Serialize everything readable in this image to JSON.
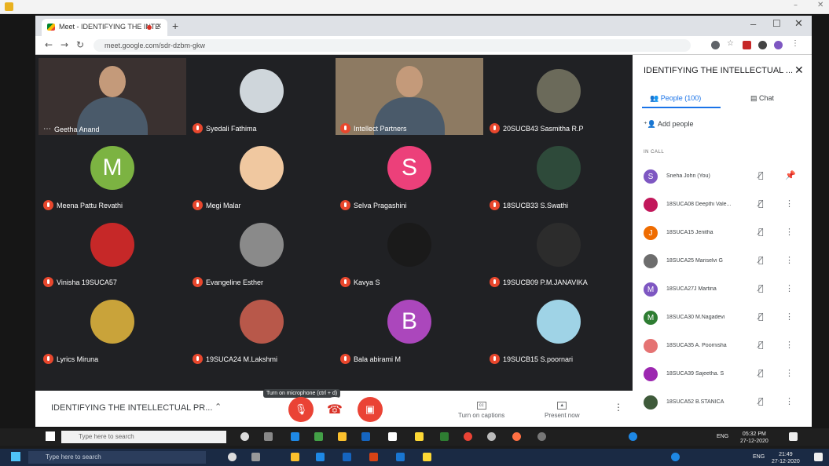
{
  "browser": {
    "tab_title": "Meet - IDENTIFYING THE INTE",
    "url": "meet.google.com/sdr-dzbm-gkw"
  },
  "tiles": [
    {
      "name": "Geetha Anand",
      "kind": "video",
      "bg": "#3a3130",
      "muted": false
    },
    {
      "name": "Syedali Fathima",
      "kind": "avatar",
      "avatar_bg": "#cfd6db",
      "muted": true
    },
    {
      "name": "Intellect Partners",
      "kind": "video",
      "bg": "#8d7a62",
      "muted": true
    },
    {
      "name": "20SUCB43 Sasmitha R.P",
      "kind": "avatar",
      "avatar_bg": "#6b6a5a",
      "muted": true
    },
    {
      "name": "Meena Pattu Revathi",
      "kind": "letter",
      "letter": "M",
      "avatar_bg": "#7cb342",
      "muted": true
    },
    {
      "name": "Megi Malar",
      "kind": "avatar",
      "avatar_bg": "#f0c8a0",
      "muted": true
    },
    {
      "name": "Selva Pragashini",
      "kind": "letter",
      "letter": "S",
      "avatar_bg": "#ec407a",
      "muted": true
    },
    {
      "name": "18SUCB33 S.Swathi",
      "kind": "avatar",
      "avatar_bg": "#2e4a3a",
      "muted": true
    },
    {
      "name": "Vinisha 19SUCA57",
      "kind": "avatar",
      "avatar_bg": "#c62828",
      "muted": true
    },
    {
      "name": "Evangeline Esther",
      "kind": "avatar",
      "avatar_bg": "#8a8a8a",
      "muted": true
    },
    {
      "name": "Kavya S",
      "kind": "avatar",
      "avatar_bg": "#1a1a1a",
      "muted": true
    },
    {
      "name": "19SUCB09 P.M.JANAVIKA",
      "kind": "avatar",
      "avatar_bg": "#2c2c2c",
      "muted": true
    },
    {
      "name": "Lyrics Miruna",
      "kind": "avatar",
      "avatar_bg": "#c9a33a",
      "muted": true
    },
    {
      "name": "19SUCA24 M.Lakshmi",
      "kind": "avatar",
      "avatar_bg": "#b8584a",
      "muted": true
    },
    {
      "name": "Bala abirami M",
      "kind": "letter",
      "letter": "B",
      "avatar_bg": "#ab47bc",
      "muted": true
    },
    {
      "name": "19SUCB15 S.poornari",
      "kind": "avatar",
      "avatar_bg": "#9fd3e6",
      "muted": true
    }
  ],
  "bottombar": {
    "meeting_title": "IDENTIFYING THE INTELLECTUAL PR...",
    "tooltip": "Turn on microphone (ctrl + d)",
    "captions_label": "Turn on captions",
    "present_label": "Present now"
  },
  "panel": {
    "title": "IDENTIFYING THE INTELLECTUAL ...",
    "people_tab": "People (100)",
    "chat_tab": "Chat",
    "add_people": "Add people",
    "in_call_label": "IN CALL",
    "people": [
      {
        "name": "Sneha John (You)",
        "initial": "S",
        "color": "#7e57c2",
        "action": "pin-icon"
      },
      {
        "name": "18SUCA08 Deepthi Vale...",
        "initial": "",
        "color": "#c2185b",
        "action": "more-icon"
      },
      {
        "name": "18SUCA15 Jenitha",
        "initial": "J",
        "color": "#ef6c00",
        "action": "more-icon"
      },
      {
        "name": "18SUCA25 Mariselvi G",
        "initial": "",
        "color": "#6d6d6d",
        "action": "more-icon"
      },
      {
        "name": "18SUCA27J Martina",
        "initial": "M",
        "color": "#7e57c2",
        "action": "more-icon"
      },
      {
        "name": "18SUCA30 M.Nagadevi",
        "initial": "M",
        "color": "#2e7d32",
        "action": "more-icon"
      },
      {
        "name": "18SUCA35 A. Poornisha",
        "initial": "",
        "color": "#e57373",
        "action": "more-icon"
      },
      {
        "name": "18SUCA39 Sajeetha. S",
        "initial": "",
        "color": "#9c27b0",
        "action": "more-icon"
      },
      {
        "name": "18SUCA52 B.STANICA",
        "initial": "",
        "color": "#3e5a3a",
        "action": "more-icon"
      }
    ]
  },
  "taskbar_inner": {
    "search_placeholder": "Type here to search",
    "time": "05:32 PM",
    "date": "27-12-2020",
    "lang": "ENG"
  },
  "taskbar_outer": {
    "search_placeholder": "Type here to search",
    "time": "21:49",
    "date": "27-12-2020",
    "lang": "ENG"
  },
  "colors": {
    "accent": "#1a73e8",
    "mute_red": "#e8472d",
    "hangup_red": "#d93025"
  }
}
